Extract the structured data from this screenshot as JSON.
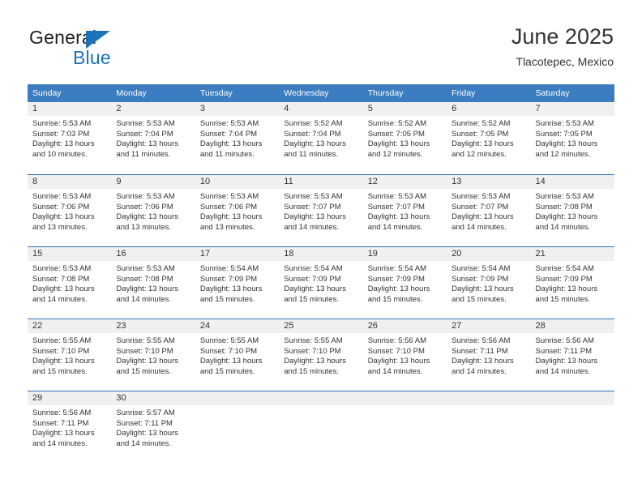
{
  "brand": {
    "line1": "General",
    "line2": "Blue",
    "triangle_icon": "blue-triangle-icon",
    "accent_color": "#1b72b8"
  },
  "header": {
    "title": "June 2025",
    "subtitle": "Tlacotepec, Mexico"
  },
  "colors": {
    "header_row_bg": "#3b7dc0",
    "week_divider": "#2f6eb5",
    "daynum_band_bg": "#f0f0f0",
    "text": "#333333"
  },
  "calendar": {
    "weekday_headers": [
      "Sunday",
      "Monday",
      "Tuesday",
      "Wednesday",
      "Thursday",
      "Friday",
      "Saturday"
    ],
    "weeks": [
      [
        {
          "day": "1",
          "sunrise": "Sunrise: 5:53 AM",
          "sunset": "Sunset: 7:03 PM",
          "daylight_1": "Daylight: 13 hours",
          "daylight_2": "and 10 minutes."
        },
        {
          "day": "2",
          "sunrise": "Sunrise: 5:53 AM",
          "sunset": "Sunset: 7:04 PM",
          "daylight_1": "Daylight: 13 hours",
          "daylight_2": "and 11 minutes."
        },
        {
          "day": "3",
          "sunrise": "Sunrise: 5:53 AM",
          "sunset": "Sunset: 7:04 PM",
          "daylight_1": "Daylight: 13 hours",
          "daylight_2": "and 11 minutes."
        },
        {
          "day": "4",
          "sunrise": "Sunrise: 5:52 AM",
          "sunset": "Sunset: 7:04 PM",
          "daylight_1": "Daylight: 13 hours",
          "daylight_2": "and 11 minutes."
        },
        {
          "day": "5",
          "sunrise": "Sunrise: 5:52 AM",
          "sunset": "Sunset: 7:05 PM",
          "daylight_1": "Daylight: 13 hours",
          "daylight_2": "and 12 minutes."
        },
        {
          "day": "6",
          "sunrise": "Sunrise: 5:52 AM",
          "sunset": "Sunset: 7:05 PM",
          "daylight_1": "Daylight: 13 hours",
          "daylight_2": "and 12 minutes."
        },
        {
          "day": "7",
          "sunrise": "Sunrise: 5:53 AM",
          "sunset": "Sunset: 7:05 PM",
          "daylight_1": "Daylight: 13 hours",
          "daylight_2": "and 12 minutes."
        }
      ],
      [
        {
          "day": "8",
          "sunrise": "Sunrise: 5:53 AM",
          "sunset": "Sunset: 7:06 PM",
          "daylight_1": "Daylight: 13 hours",
          "daylight_2": "and 13 minutes."
        },
        {
          "day": "9",
          "sunrise": "Sunrise: 5:53 AM",
          "sunset": "Sunset: 7:06 PM",
          "daylight_1": "Daylight: 13 hours",
          "daylight_2": "and 13 minutes."
        },
        {
          "day": "10",
          "sunrise": "Sunrise: 5:53 AM",
          "sunset": "Sunset: 7:06 PM",
          "daylight_1": "Daylight: 13 hours",
          "daylight_2": "and 13 minutes."
        },
        {
          "day": "11",
          "sunrise": "Sunrise: 5:53 AM",
          "sunset": "Sunset: 7:07 PM",
          "daylight_1": "Daylight: 13 hours",
          "daylight_2": "and 14 minutes."
        },
        {
          "day": "12",
          "sunrise": "Sunrise: 5:53 AM",
          "sunset": "Sunset: 7:07 PM",
          "daylight_1": "Daylight: 13 hours",
          "daylight_2": "and 14 minutes."
        },
        {
          "day": "13",
          "sunrise": "Sunrise: 5:53 AM",
          "sunset": "Sunset: 7:07 PM",
          "daylight_1": "Daylight: 13 hours",
          "daylight_2": "and 14 minutes."
        },
        {
          "day": "14",
          "sunrise": "Sunrise: 5:53 AM",
          "sunset": "Sunset: 7:08 PM",
          "daylight_1": "Daylight: 13 hours",
          "daylight_2": "and 14 minutes."
        }
      ],
      [
        {
          "day": "15",
          "sunrise": "Sunrise: 5:53 AM",
          "sunset": "Sunset: 7:08 PM",
          "daylight_1": "Daylight: 13 hours",
          "daylight_2": "and 14 minutes."
        },
        {
          "day": "16",
          "sunrise": "Sunrise: 5:53 AM",
          "sunset": "Sunset: 7:08 PM",
          "daylight_1": "Daylight: 13 hours",
          "daylight_2": "and 14 minutes."
        },
        {
          "day": "17",
          "sunrise": "Sunrise: 5:54 AM",
          "sunset": "Sunset: 7:09 PM",
          "daylight_1": "Daylight: 13 hours",
          "daylight_2": "and 15 minutes."
        },
        {
          "day": "18",
          "sunrise": "Sunrise: 5:54 AM",
          "sunset": "Sunset: 7:09 PM",
          "daylight_1": "Daylight: 13 hours",
          "daylight_2": "and 15 minutes."
        },
        {
          "day": "19",
          "sunrise": "Sunrise: 5:54 AM",
          "sunset": "Sunset: 7:09 PM",
          "daylight_1": "Daylight: 13 hours",
          "daylight_2": "and 15 minutes."
        },
        {
          "day": "20",
          "sunrise": "Sunrise: 5:54 AM",
          "sunset": "Sunset: 7:09 PM",
          "daylight_1": "Daylight: 13 hours",
          "daylight_2": "and 15 minutes."
        },
        {
          "day": "21",
          "sunrise": "Sunrise: 5:54 AM",
          "sunset": "Sunset: 7:09 PM",
          "daylight_1": "Daylight: 13 hours",
          "daylight_2": "and 15 minutes."
        }
      ],
      [
        {
          "day": "22",
          "sunrise": "Sunrise: 5:55 AM",
          "sunset": "Sunset: 7:10 PM",
          "daylight_1": "Daylight: 13 hours",
          "daylight_2": "and 15 minutes."
        },
        {
          "day": "23",
          "sunrise": "Sunrise: 5:55 AM",
          "sunset": "Sunset: 7:10 PM",
          "daylight_1": "Daylight: 13 hours",
          "daylight_2": "and 15 minutes."
        },
        {
          "day": "24",
          "sunrise": "Sunrise: 5:55 AM",
          "sunset": "Sunset: 7:10 PM",
          "daylight_1": "Daylight: 13 hours",
          "daylight_2": "and 15 minutes."
        },
        {
          "day": "25",
          "sunrise": "Sunrise: 5:55 AM",
          "sunset": "Sunset: 7:10 PM",
          "daylight_1": "Daylight: 13 hours",
          "daylight_2": "and 15 minutes."
        },
        {
          "day": "26",
          "sunrise": "Sunrise: 5:56 AM",
          "sunset": "Sunset: 7:10 PM",
          "daylight_1": "Daylight: 13 hours",
          "daylight_2": "and 14 minutes."
        },
        {
          "day": "27",
          "sunrise": "Sunrise: 5:56 AM",
          "sunset": "Sunset: 7:11 PM",
          "daylight_1": "Daylight: 13 hours",
          "daylight_2": "and 14 minutes."
        },
        {
          "day": "28",
          "sunrise": "Sunrise: 5:56 AM",
          "sunset": "Sunset: 7:11 PM",
          "daylight_1": "Daylight: 13 hours",
          "daylight_2": "and 14 minutes."
        }
      ],
      [
        {
          "day": "29",
          "sunrise": "Sunrise: 5:56 AM",
          "sunset": "Sunset: 7:11 PM",
          "daylight_1": "Daylight: 13 hours",
          "daylight_2": "and 14 minutes."
        },
        {
          "day": "30",
          "sunrise": "Sunrise: 5:57 AM",
          "sunset": "Sunset: 7:11 PM",
          "daylight_1": "Daylight: 13 hours",
          "daylight_2": "and 14 minutes."
        },
        {
          "day": "",
          "sunrise": "",
          "sunset": "",
          "daylight_1": "",
          "daylight_2": ""
        },
        {
          "day": "",
          "sunrise": "",
          "sunset": "",
          "daylight_1": "",
          "daylight_2": ""
        },
        {
          "day": "",
          "sunrise": "",
          "sunset": "",
          "daylight_1": "",
          "daylight_2": ""
        },
        {
          "day": "",
          "sunrise": "",
          "sunset": "",
          "daylight_1": "",
          "daylight_2": ""
        },
        {
          "day": "",
          "sunrise": "",
          "sunset": "",
          "daylight_1": "",
          "daylight_2": ""
        }
      ]
    ]
  }
}
